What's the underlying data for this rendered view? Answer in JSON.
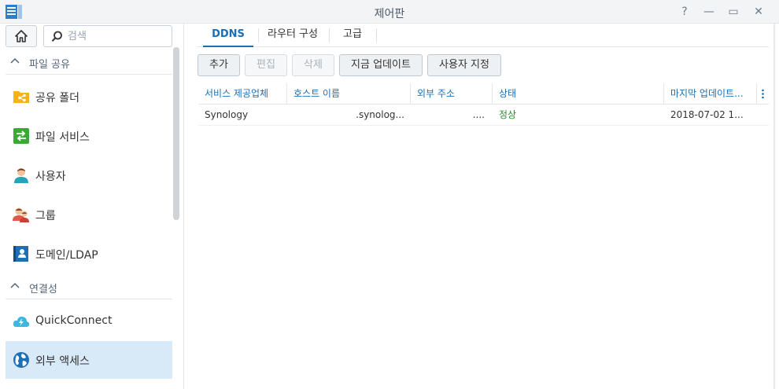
{
  "window": {
    "title": "제어판",
    "controls": {
      "help": "?",
      "minimize": "—",
      "maximize": "▭",
      "close": "✕"
    }
  },
  "search": {
    "placeholder": "검색"
  },
  "sidebar": {
    "sections": [
      {
        "label": "파일 공유"
      },
      {
        "label": "연결성"
      }
    ],
    "items": [
      {
        "label": "공유 폴더",
        "icon": "shared-folder-icon"
      },
      {
        "label": "파일 서비스",
        "icon": "file-services-icon"
      },
      {
        "label": "사용자",
        "icon": "user-icon"
      },
      {
        "label": "그룹",
        "icon": "group-icon"
      },
      {
        "label": "도메인/LDAP",
        "icon": "domain-ldap-icon"
      },
      {
        "label": "QuickConnect",
        "icon": "quickconnect-icon"
      },
      {
        "label": "외부 액세스",
        "icon": "external-access-icon"
      }
    ],
    "active_item": "외부 액세스"
  },
  "tabs": [
    {
      "label": "DDNS",
      "active": true
    },
    {
      "label": "라우터 구성",
      "active": false
    },
    {
      "label": "고급",
      "active": false
    }
  ],
  "toolbar": {
    "add": "추가",
    "edit": "편집",
    "delete": "삭제",
    "update_now": "지금 업데이트",
    "customize": "사용자 지정"
  },
  "grid": {
    "columns": [
      "서비스 제공업체",
      "호스트 이름",
      "외부 주소",
      "상태",
      "마지막 업데이트..."
    ],
    "rows": [
      {
        "provider": "Synology",
        "hostname": ".synolog...",
        "external_address": "....",
        "status": "정상",
        "last_update": "2018-07-02 1..."
      }
    ]
  },
  "colors": {
    "accent": "#1a6fb5",
    "active_bg": "#d8e9f8",
    "status_ok": "#2e8b2e"
  }
}
